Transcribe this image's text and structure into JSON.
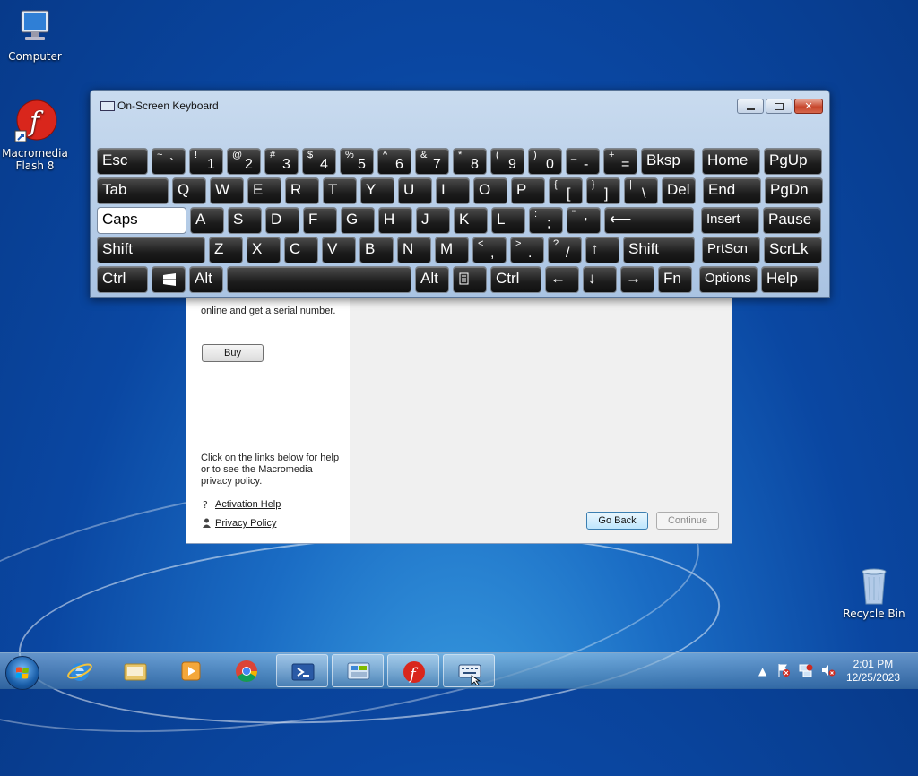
{
  "desktop": {
    "icons": [
      {
        "label_lines": [
          "Computer"
        ]
      },
      {
        "label_lines": [
          "Macromedia",
          "Flash 8"
        ]
      },
      {
        "label_lines": [
          "Recycle Bin"
        ]
      }
    ]
  },
  "activation_dialog": {
    "partial_text": "online and get a serial number.",
    "buy_label": "Buy",
    "help_text": "Click on the links below for help or to see the Macromedia privacy policy.",
    "links": [
      "Activation Help",
      "Privacy Policy"
    ],
    "go_back_label": "Go Back",
    "continue_label": "Continue"
  },
  "osk": {
    "title": "On-Screen Keyboard",
    "rows": [
      [
        {
          "main": "Esc"
        },
        {
          "top": "~",
          "bottom": "`"
        },
        {
          "top": "!",
          "bottom": "1"
        },
        {
          "top": "@",
          "bottom": "2"
        },
        {
          "top": "#",
          "bottom": "3"
        },
        {
          "top": "$",
          "bottom": "4"
        },
        {
          "top": "%",
          "bottom": "5"
        },
        {
          "top": "^",
          "bottom": "6"
        },
        {
          "top": "&",
          "bottom": "7"
        },
        {
          "top": "*",
          "bottom": "8"
        },
        {
          "top": "(",
          "bottom": "9"
        },
        {
          "top": ")",
          "bottom": "0"
        },
        {
          "top": "_",
          "bottom": "-"
        },
        {
          "top": "+",
          "bottom": "="
        },
        {
          "main": "Bksp"
        },
        {
          "main": "Home"
        },
        {
          "main": "PgUp"
        }
      ],
      [
        {
          "main": "Tab"
        },
        {
          "main": "Q"
        },
        {
          "main": "W"
        },
        {
          "main": "E"
        },
        {
          "main": "R"
        },
        {
          "main": "T"
        },
        {
          "main": "Y"
        },
        {
          "main": "U"
        },
        {
          "main": "I"
        },
        {
          "main": "O"
        },
        {
          "main": "P"
        },
        {
          "top": "{",
          "bottom": "["
        },
        {
          "top": "}",
          "bottom": "]"
        },
        {
          "top": "|",
          "bottom": "\\"
        },
        {
          "main": "Del"
        },
        {
          "main": "End"
        },
        {
          "main": "PgDn"
        }
      ],
      [
        {
          "main": "Caps"
        },
        {
          "main": "A"
        },
        {
          "main": "S"
        },
        {
          "main": "D"
        },
        {
          "main": "F"
        },
        {
          "main": "G"
        },
        {
          "main": "H"
        },
        {
          "main": "J"
        },
        {
          "main": "K"
        },
        {
          "main": "L"
        },
        {
          "top": ":",
          "bottom": ";"
        },
        {
          "top": "\"",
          "bottom": "'"
        },
        {
          "main": "⟵"
        },
        {
          "main": "Insert"
        },
        {
          "main": "Pause"
        }
      ],
      [
        {
          "main": "Shift"
        },
        {
          "main": "Z"
        },
        {
          "main": "X"
        },
        {
          "main": "C"
        },
        {
          "main": "V"
        },
        {
          "main": "B"
        },
        {
          "main": "N"
        },
        {
          "main": "M"
        },
        {
          "top": "<",
          "bottom": ","
        },
        {
          "top": ">",
          "bottom": "."
        },
        {
          "top": "?",
          "bottom": "/"
        },
        {
          "main": "↑"
        },
        {
          "main": "Shift"
        },
        {
          "main": "PrtScn"
        },
        {
          "main": "ScrLk"
        }
      ],
      [
        {
          "main": "Ctrl"
        },
        {
          "main": ""
        },
        {
          "main": "Alt"
        },
        {
          "main": ""
        },
        {
          "main": "Alt"
        },
        {
          "main": ""
        },
        {
          "main": "Ctrl"
        },
        {
          "main": "←"
        },
        {
          "main": "↓"
        },
        {
          "main": "→"
        },
        {
          "main": "Fn"
        },
        {
          "main": "Options"
        },
        {
          "main": "Help"
        }
      ]
    ]
  },
  "taskbar": {
    "time": "2:01 PM",
    "date": "12/25/2023",
    "tray_chevron": "▲"
  }
}
